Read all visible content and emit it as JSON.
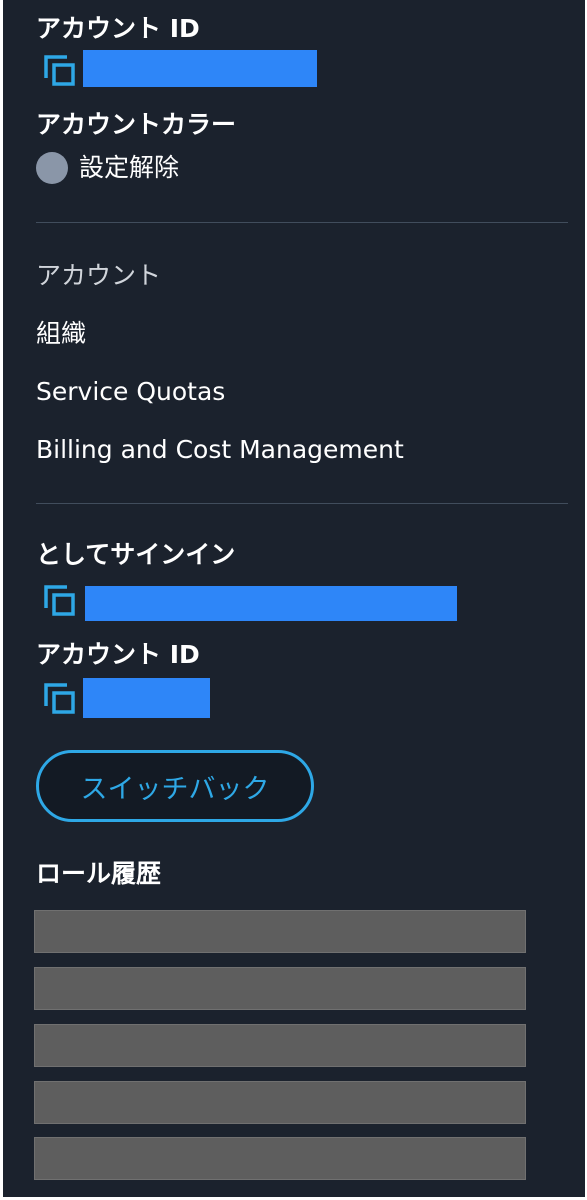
{
  "account": {
    "id_heading": "アカウント ID",
    "color_heading": "アカウントカラー",
    "color_value": "設定解除",
    "color_swatch": "#8a96a8"
  },
  "menu": {
    "items": [
      {
        "label": "アカウント"
      },
      {
        "label": "組織"
      },
      {
        "label": "Service Quotas"
      },
      {
        "label": "Billing and Cost Management"
      }
    ]
  },
  "session": {
    "signed_in_as_heading": "としてサインイン",
    "account_id_heading": "アカウント ID",
    "switch_back_label": "スイッチバック"
  },
  "role_history": {
    "heading": "ロール履歴",
    "entries_redacted": 5
  },
  "icons": {
    "copy": "copy-icon"
  },
  "colors": {
    "background": "#1b222d",
    "accent": "#2ea8e6",
    "redaction_blue": "#2e86f8",
    "redaction_gray": "#5e5e5e"
  }
}
